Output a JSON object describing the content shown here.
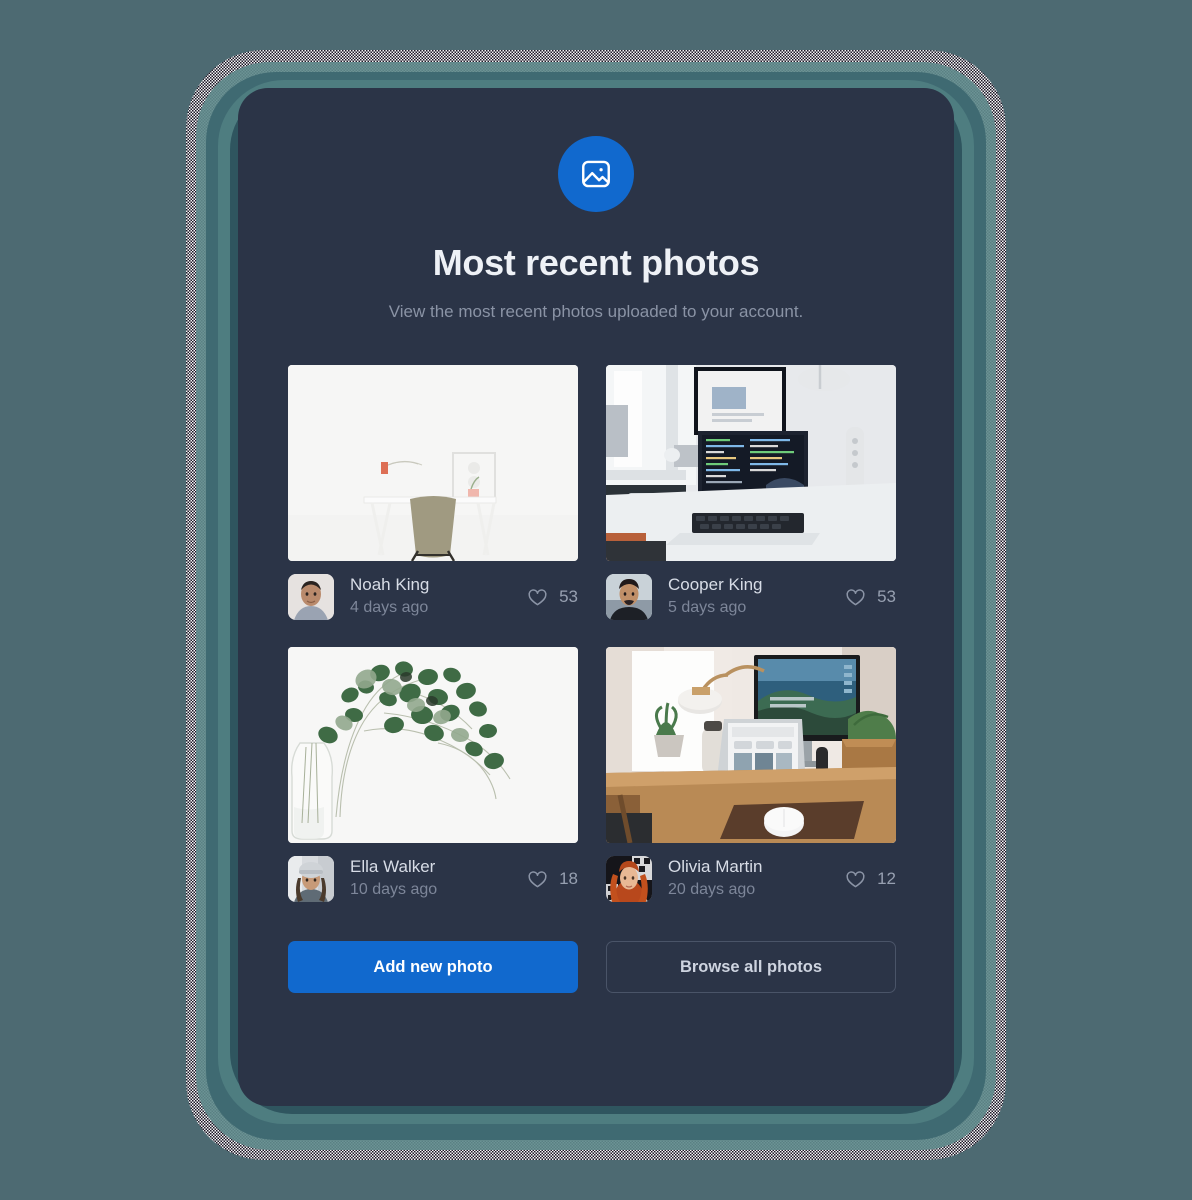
{
  "theme": {
    "page_background": "#4d6a72",
    "card_background": "#2b3447",
    "accent": "#1169ce",
    "title_color": "#eef1f6",
    "muted_text": "#8a93a5"
  },
  "header": {
    "icon": "image-icon",
    "title": "Most recent photos",
    "subtitle": "View the most recent photos uploaded to your account."
  },
  "photos": [
    {
      "image_alt": "minimal-white-desk-with-chair",
      "avatar_alt": "portrait-of-noah-king",
      "person": "Noah King",
      "ago": "4 days ago",
      "likes": "53",
      "like_icon": "heart-icon"
    },
    {
      "image_alt": "laptop-with-code-and-monitor-on-white-desk",
      "avatar_alt": "portrait-of-cooper-king",
      "person": "Cooper King",
      "ago": "5 days ago",
      "likes": "53",
      "like_icon": "heart-icon"
    },
    {
      "image_alt": "eucalyptus-branches-in-glass-vase",
      "avatar_alt": "portrait-of-ella-walker",
      "person": "Ella Walker",
      "ago": "10 days ago",
      "likes": "18",
      "like_icon": "heart-icon"
    },
    {
      "image_alt": "wooden-desk-with-laptop-monitor-and-plants",
      "avatar_alt": "portrait-of-olivia-martin",
      "person": "Olivia Martin",
      "ago": "20 days ago",
      "likes": "12",
      "like_icon": "heart-icon"
    }
  ],
  "actions": {
    "primary_label": "Add new photo",
    "secondary_label": "Browse all photos"
  }
}
